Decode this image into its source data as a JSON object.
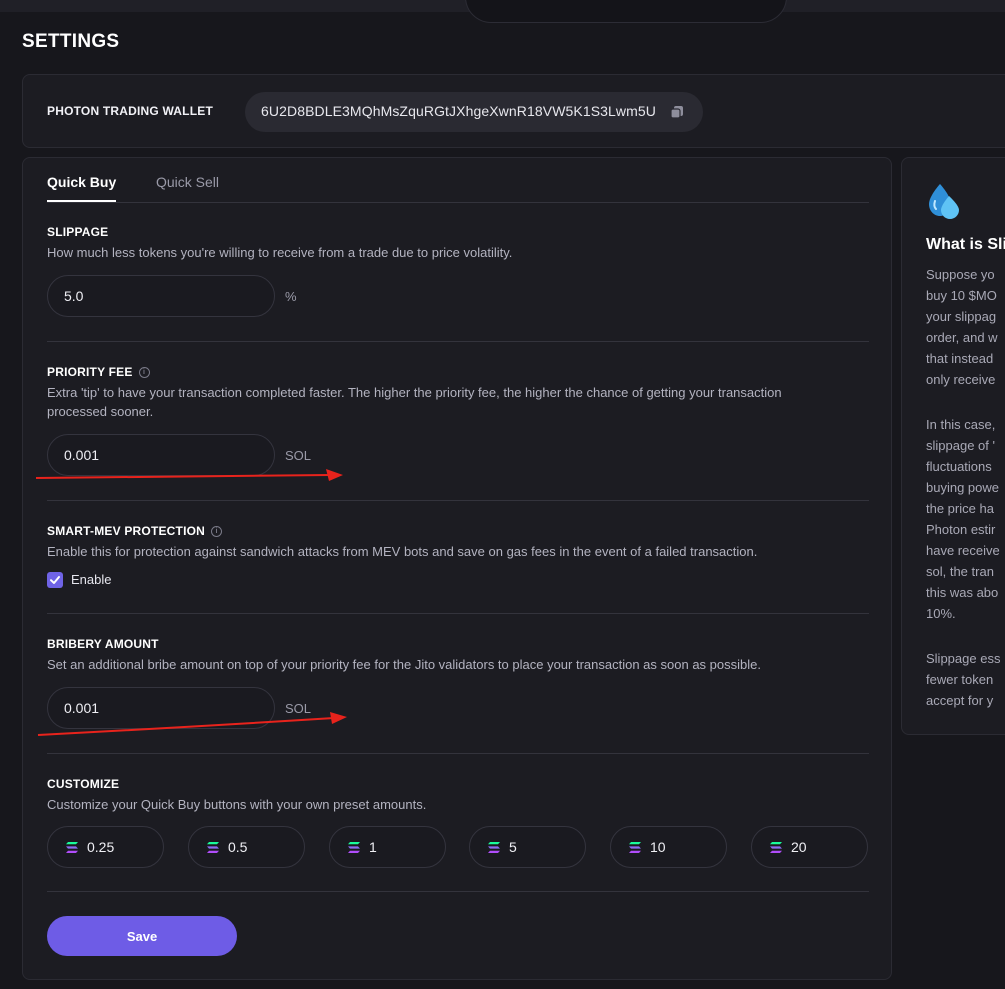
{
  "page_title": "SETTINGS",
  "wallet": {
    "label": "PHOTON TRADING WALLET",
    "address": "6U2D8BDLE3MQhMsZquRGtJXhgeXwnR18VW5K1S3Lwm5U"
  },
  "tabs": [
    {
      "label": "Quick Buy",
      "active": true
    },
    {
      "label": "Quick Sell",
      "active": false
    }
  ],
  "slippage": {
    "title": "SLIPPAGE",
    "description": "How much less tokens you're willing to receive from a trade due to price volatility.",
    "value": "5.0",
    "unit": "%"
  },
  "priority_fee": {
    "title": "PRIORITY FEE",
    "description_1": "Extra 'tip' to have your transaction completed faster. The higher the priority fee, the higher the chance of getting your transaction",
    "description_2": "processed sooner.",
    "value": "0.001",
    "unit": "SOL"
  },
  "mev": {
    "title": "SMART-MEV PROTECTION",
    "description": "Enable this for protection against sandwich attacks from MEV bots and save on gas fees in the event of a failed transaction.",
    "checkbox_label": "Enable",
    "checked": true
  },
  "bribery": {
    "title": "BRIBERY AMOUNT",
    "description": "Set an additional bribe amount on top of your priority fee for the Jito validators to place your transaction as soon as possible.",
    "value": "0.001",
    "unit": "SOL"
  },
  "customize": {
    "title": "CUSTOMIZE",
    "description": "Customize your Quick Buy buttons with your own preset amounts.",
    "presets": [
      "0.25",
      "0.5",
      "1",
      "5",
      "10",
      "20"
    ]
  },
  "save_label": "Save",
  "help": {
    "title": "What is Sli",
    "lines": [
      "Suppose yo",
      "buy 10 $MO",
      "your slippag",
      "order, and w",
      "that instead",
      "only receive",
      "",
      "In this case,",
      "slippage of '",
      "fluctuations",
      "buying powe",
      "the price ha",
      "Photon estir",
      "have receive",
      "sol, the tran",
      "this was abo",
      "10%.",
      "",
      "Slippage ess",
      "fewer token",
      "accept for y"
    ]
  },
  "colors": {
    "accent": "#6e5ce6",
    "background": "#17171c",
    "card": "#1c1c22",
    "annotation_arrow": "#e8231c"
  }
}
